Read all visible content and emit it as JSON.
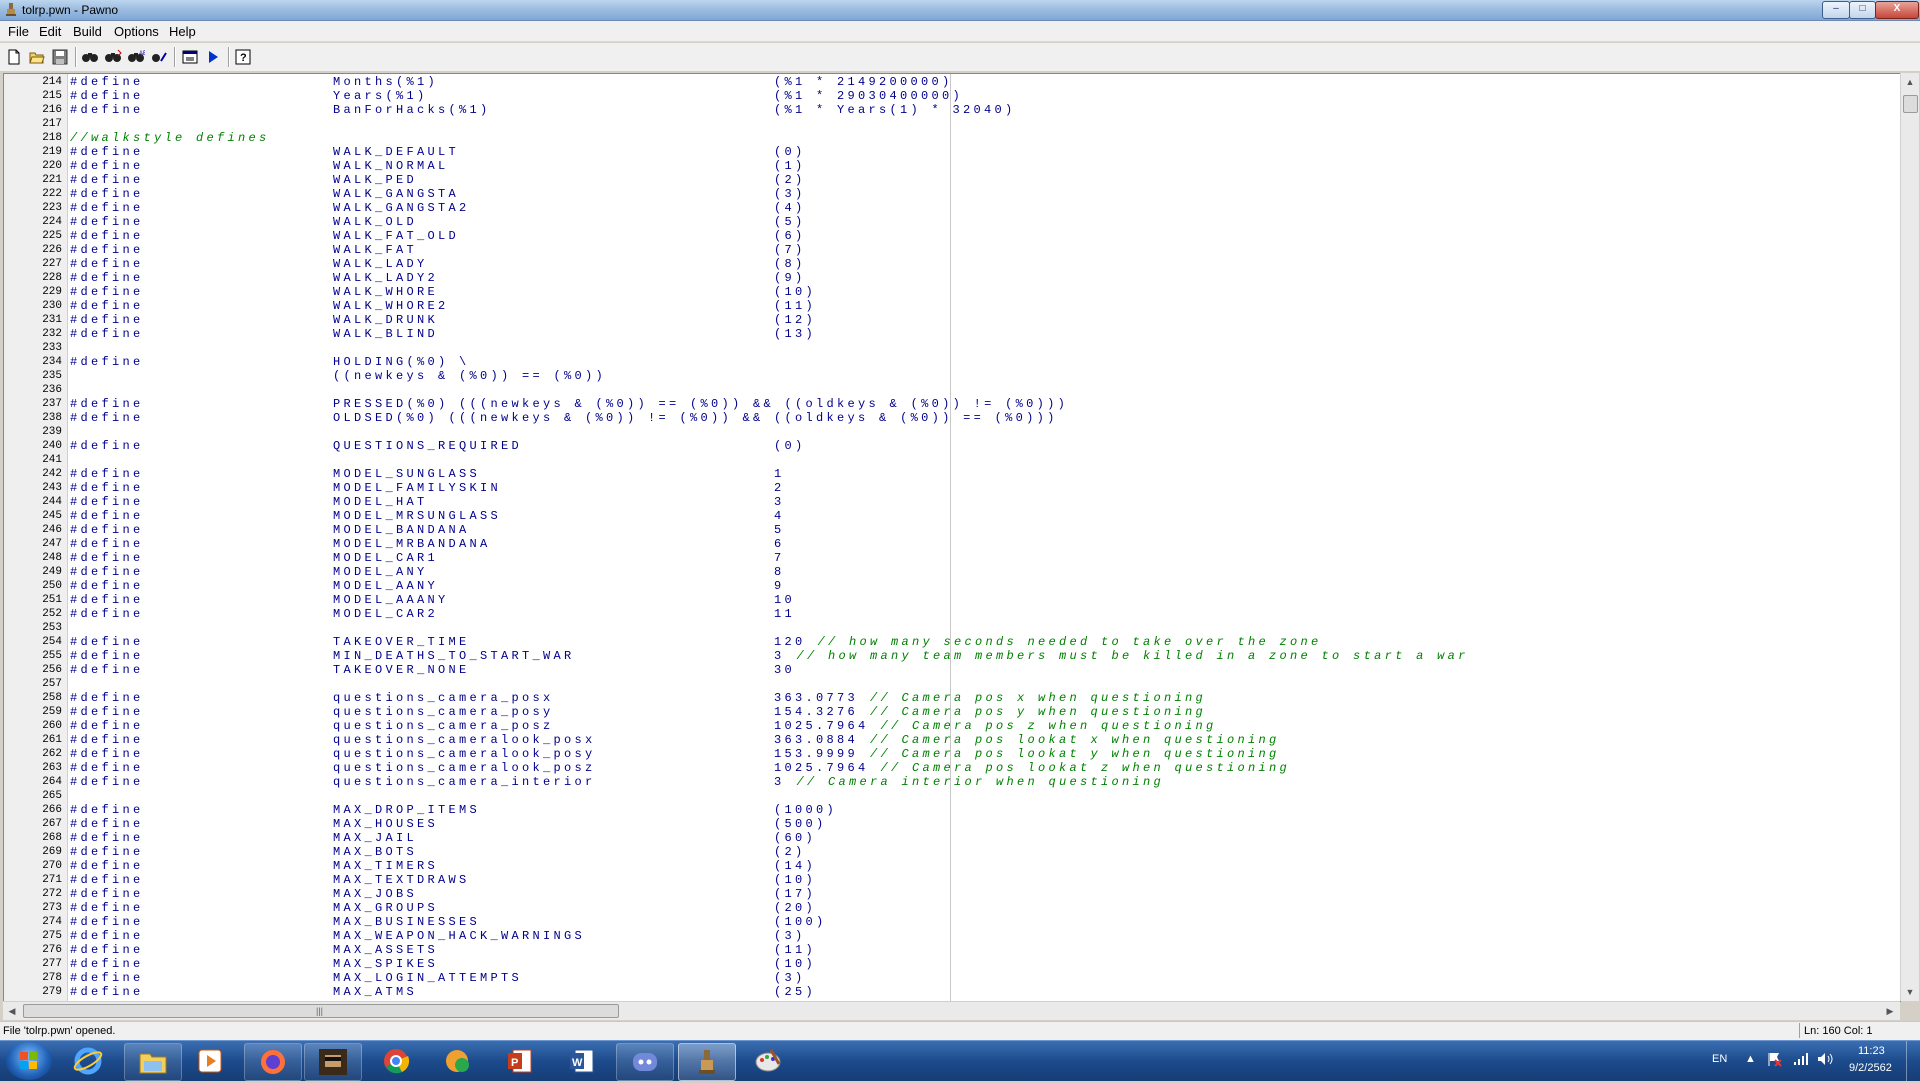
{
  "window": {
    "title": "tolrp.pwn - Pawno",
    "minimize_glyph": "–",
    "maximize_glyph": "□",
    "close_glyph": "X"
  },
  "menubar": {
    "items": [
      "File",
      "Edit",
      "Build",
      "Options",
      "Help"
    ]
  },
  "toolbar": {
    "icons": [
      "new-file-icon",
      "open-file-icon",
      "save-icon",
      "find-icon",
      "find-next-icon",
      "replace-icon",
      "goto-line-icon",
      "function-list-icon",
      "compile-run-icon",
      "help-icon"
    ]
  },
  "colors": {
    "keyword": "#00008b",
    "comment": "#008000",
    "gutter": "#efefef",
    "taskbar": "#1c4b8c"
  },
  "editor": {
    "lines": [
      {
        "num": "214",
        "directive": "#define",
        "name": "Months(%1)",
        "value": "(%1 * 2149200000)",
        "comment": ""
      },
      {
        "num": "215",
        "directive": "#define",
        "name": "Years(%1)",
        "value": "(%1 * 29030400000)",
        "comment": ""
      },
      {
        "num": "216",
        "directive": "#define",
        "name": "BanForHacks(%1)",
        "value": "(%1 * Years(1) * 32040)",
        "comment": ""
      },
      {
        "num": "217",
        "directive": "",
        "name": "",
        "value": "",
        "comment": ""
      },
      {
        "num": "218",
        "directive": "",
        "name": "",
        "value": "",
        "comment": "//walkstyle defines"
      },
      {
        "num": "219",
        "directive": "#define",
        "name": "WALK_DEFAULT",
        "value": "(0)",
        "comment": ""
      },
      {
        "num": "220",
        "directive": "#define",
        "name": "WALK_NORMAL",
        "value": "(1)",
        "comment": ""
      },
      {
        "num": "221",
        "directive": "#define",
        "name": "WALK_PED",
        "value": "(2)",
        "comment": ""
      },
      {
        "num": "222",
        "directive": "#define",
        "name": "WALK_GANGSTA",
        "value": "(3)",
        "comment": ""
      },
      {
        "num": "223",
        "directive": "#define",
        "name": "WALK_GANGSTA2",
        "value": "(4)",
        "comment": ""
      },
      {
        "num": "224",
        "directive": "#define",
        "name": "WALK_OLD",
        "value": "(5)",
        "comment": ""
      },
      {
        "num": "225",
        "directive": "#define",
        "name": "WALK_FAT_OLD",
        "value": "(6)",
        "comment": ""
      },
      {
        "num": "226",
        "directive": "#define",
        "name": "WALK_FAT",
        "value": "(7)",
        "comment": ""
      },
      {
        "num": "227",
        "directive": "#define",
        "name": "WALK_LADY",
        "value": "(8)",
        "comment": ""
      },
      {
        "num": "228",
        "directive": "#define",
        "name": "WALK_LADY2",
        "value": "(9)",
        "comment": ""
      },
      {
        "num": "229",
        "directive": "#define",
        "name": "WALK_WHORE",
        "value": "(10)",
        "comment": ""
      },
      {
        "num": "230",
        "directive": "#define",
        "name": "WALK_WHORE2",
        "value": "(11)",
        "comment": ""
      },
      {
        "num": "231",
        "directive": "#define",
        "name": "WALK_DRUNK",
        "value": "(12)",
        "comment": ""
      },
      {
        "num": "232",
        "directive": "#define",
        "name": "WALK_BLIND",
        "value": "(13)",
        "comment": ""
      },
      {
        "num": "233",
        "directive": "",
        "name": "",
        "value": "",
        "comment": ""
      },
      {
        "num": "234",
        "directive": "#define",
        "name": "HOLDING(%0) \\",
        "value": "",
        "comment": ""
      },
      {
        "num": "235",
        "directive": "",
        "name": "((newkeys & (%0)) == (%0))",
        "value": "",
        "comment": ""
      },
      {
        "num": "236",
        "directive": "",
        "name": "",
        "value": "",
        "comment": ""
      },
      {
        "num": "237",
        "directive": "#define",
        "name": "PRESSED(%0) (((newkeys & (%0)) == (%0)) && ((oldkeys & (%0)) != (%0)))",
        "value": "",
        "comment": ""
      },
      {
        "num": "238",
        "directive": "#define",
        "name": "OLDSED(%0) (((newkeys & (%0)) != (%0)) && ((oldkeys & (%0)) == (%0)))",
        "value": "",
        "comment": ""
      },
      {
        "num": "239",
        "directive": "",
        "name": "",
        "value": "",
        "comment": ""
      },
      {
        "num": "240",
        "directive": "#define",
        "name": "QUESTIONS_REQUIRED",
        "value": "(0)",
        "comment": ""
      },
      {
        "num": "241",
        "directive": "",
        "name": "",
        "value": "",
        "comment": ""
      },
      {
        "num": "242",
        "directive": "#define",
        "name": "MODEL_SUNGLASS",
        "value": "1",
        "comment": ""
      },
      {
        "num": "243",
        "directive": "#define",
        "name": "MODEL_FAMILYSKIN",
        "value": "2",
        "comment": ""
      },
      {
        "num": "244",
        "directive": "#define",
        "name": "MODEL_HAT",
        "value": "3",
        "comment": ""
      },
      {
        "num": "245",
        "directive": "#define",
        "name": "MODEL_MRSUNGLASS",
        "value": "4",
        "comment": ""
      },
      {
        "num": "246",
        "directive": "#define",
        "name": "MODEL_BANDANA",
        "value": "5",
        "comment": ""
      },
      {
        "num": "247",
        "directive": "#define",
        "name": "MODEL_MRBANDANA",
        "value": "6",
        "comment": ""
      },
      {
        "num": "248",
        "directive": "#define",
        "name": "MODEL_CAR1",
        "value": "7",
        "comment": ""
      },
      {
        "num": "249",
        "directive": "#define",
        "name": "MODEL_ANY",
        "value": "8",
        "comment": ""
      },
      {
        "num": "250",
        "directive": "#define",
        "name": "MODEL_AANY",
        "value": "9",
        "comment": ""
      },
      {
        "num": "251",
        "directive": "#define",
        "name": "MODEL_AAANY",
        "value": "10",
        "comment": ""
      },
      {
        "num": "252",
        "directive": "#define",
        "name": "MODEL_CAR2",
        "value": "11",
        "comment": ""
      },
      {
        "num": "253",
        "directive": "",
        "name": "",
        "value": "",
        "comment": ""
      },
      {
        "num": "254",
        "directive": "#define",
        "name": "TAKEOVER_TIME",
        "value": "120",
        "comment": "// how many seconds needed to take over the zone"
      },
      {
        "num": "255",
        "directive": "#define",
        "name": "MIN_DEATHS_TO_START_WAR",
        "value": "3",
        "comment": "// how many team members must be killed in a zone to start a war"
      },
      {
        "num": "256",
        "directive": "#define",
        "name": "TAKEOVER_NONE",
        "value": "30",
        "comment": ""
      },
      {
        "num": "257",
        "directive": "",
        "name": "",
        "value": "",
        "comment": ""
      },
      {
        "num": "258",
        "directive": "#define",
        "name": "questions_camera_posx",
        "value": "363.0773",
        "comment": "// Camera pos x when questioning"
      },
      {
        "num": "259",
        "directive": "#define",
        "name": "questions_camera_posy",
        "value": "154.3276",
        "comment": "// Camera pos y when questioning"
      },
      {
        "num": "260",
        "directive": "#define",
        "name": "questions_camera_posz",
        "value": "1025.7964",
        "comment": "// Camera pos z when questioning"
      },
      {
        "num": "261",
        "directive": "#define",
        "name": "questions_cameralook_posx",
        "value": "363.0884",
        "comment": "// Camera pos lookat x when questioning"
      },
      {
        "num": "262",
        "directive": "#define",
        "name": "questions_cameralook_posy",
        "value": "153.9999",
        "comment": "// Camera pos lookat y when questioning"
      },
      {
        "num": "263",
        "directive": "#define",
        "name": "questions_cameralook_posz",
        "value": "1025.7964",
        "comment": "// Camera pos lookat z when questioning"
      },
      {
        "num": "264",
        "directive": "#define",
        "name": "questions_camera_interior",
        "value": "3",
        "comment": "// Camera interior when questioning"
      },
      {
        "num": "265",
        "directive": "",
        "name": "",
        "value": "",
        "comment": ""
      },
      {
        "num": "266",
        "directive": "#define",
        "name": "MAX_DROP_ITEMS",
        "value": "(1000)",
        "comment": ""
      },
      {
        "num": "267",
        "directive": "#define",
        "name": "MAX_HOUSES",
        "value": "(500)",
        "comment": ""
      },
      {
        "num": "268",
        "directive": "#define",
        "name": "MAX_JAIL",
        "value": "(60)",
        "comment": ""
      },
      {
        "num": "269",
        "directive": "#define",
        "name": "MAX_BOTS",
        "value": "(2)",
        "comment": ""
      },
      {
        "num": "270",
        "directive": "#define",
        "name": "MAX_TIMERS",
        "value": "(14)",
        "comment": ""
      },
      {
        "num": "271",
        "directive": "#define",
        "name": "MAX_TEXTDRAWS",
        "value": "(10)",
        "comment": ""
      },
      {
        "num": "272",
        "directive": "#define",
        "name": "MAX_JOBS",
        "value": "(17)",
        "comment": ""
      },
      {
        "num": "273",
        "directive": "#define",
        "name": "MAX_GROUPS",
        "value": "(20)",
        "comment": ""
      },
      {
        "num": "274",
        "directive": "#define",
        "name": "MAX_BUSINESSES",
        "value": "(100)",
        "comment": ""
      },
      {
        "num": "275",
        "directive": "#define",
        "name": "MAX_WEAPON_HACK_WARNINGS",
        "value": "(3)",
        "comment": ""
      },
      {
        "num": "276",
        "directive": "#define",
        "name": "MAX_ASSETS",
        "value": "(11)",
        "comment": ""
      },
      {
        "num": "277",
        "directive": "#define",
        "name": "MAX_SPIKES",
        "value": "(10)",
        "comment": ""
      },
      {
        "num": "278",
        "directive": "#define",
        "name": "MAX_LOGIN_ATTEMPTS",
        "value": "(3)",
        "comment": ""
      },
      {
        "num": "279",
        "directive": "#define",
        "name": "MAX_ATMS",
        "value": "(25)",
        "comment": ""
      }
    ]
  },
  "statusbar": {
    "message": "File 'tolrp.pwn' opened.",
    "position": "Ln: 160  Col: 1"
  },
  "taskbar": {
    "apps": [
      "internet-explorer-icon",
      "file-explorer-icon",
      "media-player-icon",
      "firefox-icon",
      "game-icon",
      "chrome-icon",
      "security-icon",
      "powerpoint-icon",
      "word-icon",
      "discord-icon",
      "pawno-icon",
      "paint-icon"
    ],
    "language": "EN",
    "time": "11:23",
    "date": "9/2/2562"
  }
}
